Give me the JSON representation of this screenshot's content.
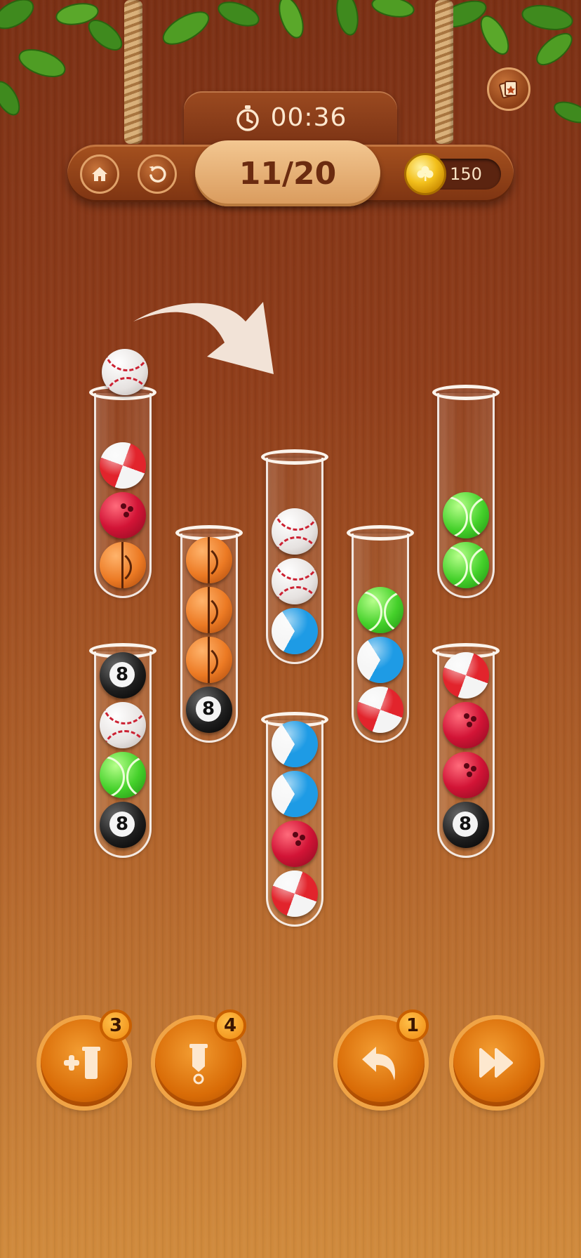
{
  "header": {
    "timer": "00:36",
    "level": "11/20",
    "coins": "150"
  },
  "icons": {
    "home": "home-icon",
    "restart": "restart-icon",
    "timer": "stopwatch-icon",
    "coin": "clover-coin-icon",
    "corner": "card-deck-icon",
    "hint_arrow": "curved-arrow-icon"
  },
  "lifted_ball": "baseball",
  "tubes": [
    {
      "id": "tube-1",
      "balls_top_to_bottom": [
        "beach",
        "bowling",
        "basket"
      ]
    },
    {
      "id": "tube-2",
      "balls_top_to_bottom": [
        "basket",
        "basket",
        "basket",
        "eight"
      ]
    },
    {
      "id": "tube-3",
      "balls_top_to_bottom": [
        "baseball",
        "baseball",
        "volley"
      ]
    },
    {
      "id": "tube-4",
      "balls_top_to_bottom": [
        "tennis",
        "volley",
        "beach"
      ]
    },
    {
      "id": "tube-5",
      "balls_top_to_bottom": [
        "tennis",
        "tennis"
      ]
    },
    {
      "id": "tube-6",
      "balls_top_to_bottom": [
        "eight",
        "baseball",
        "tennis",
        "eight"
      ]
    },
    {
      "id": "tube-7",
      "balls_top_to_bottom": [
        "volley",
        "volley",
        "bowling",
        "beach"
      ]
    },
    {
      "id": "tube-8",
      "balls_top_to_bottom": [
        "beach",
        "bowling",
        "bowling",
        "eight"
      ]
    }
  ],
  "eight_ball_number": "8",
  "actions": {
    "add_tube": {
      "badge": "3",
      "icon": "add-tube-icon"
    },
    "clear_tube": {
      "badge": "4",
      "icon": "clear-tube-icon"
    },
    "undo": {
      "badge": "1",
      "icon": "undo-icon"
    },
    "skip": {
      "icon": "fast-forward-icon"
    }
  },
  "colors": {
    "wood_dark": "#7a2f14",
    "wood_light": "#d08a3c",
    "button_orange": "#e0780e",
    "level_text": "#6b2b10"
  }
}
